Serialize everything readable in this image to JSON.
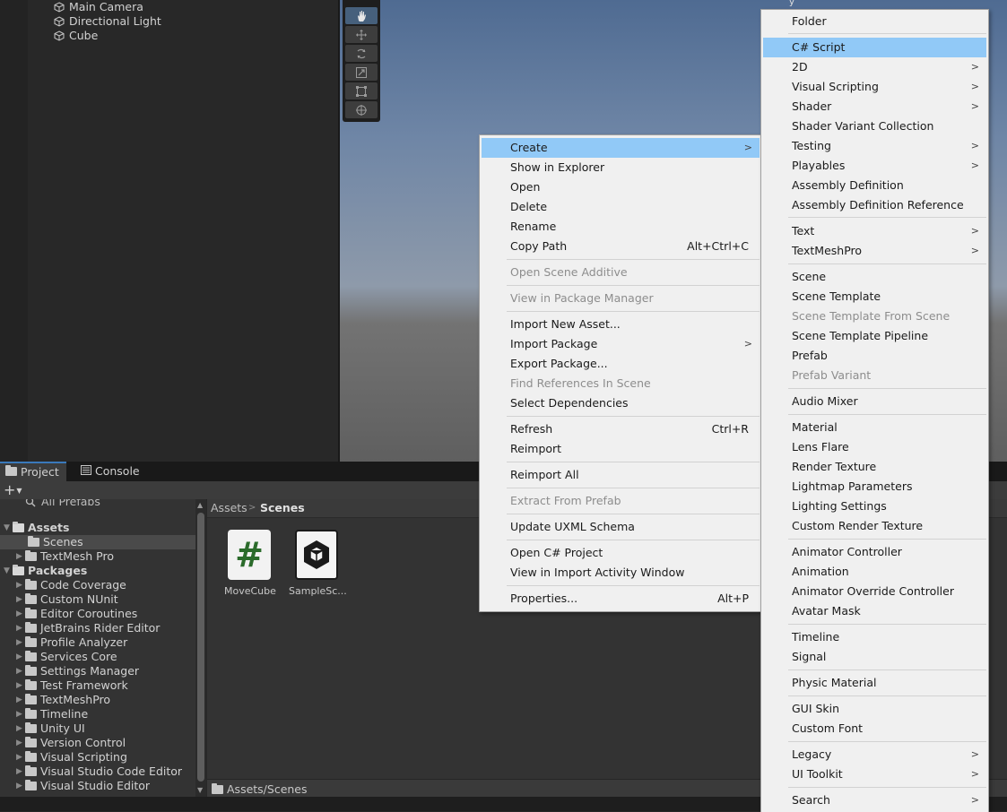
{
  "hierarchy": {
    "items": [
      "Main Camera",
      "Directional Light",
      "Cube"
    ]
  },
  "scene": {
    "axis_label": "y"
  },
  "tabs": {
    "project": "Project",
    "console": "Console"
  },
  "project": {
    "add_button": "+",
    "search_partial": "All Prefabs",
    "tree": [
      {
        "label": "Assets",
        "bold": true
      },
      {
        "label": "Scenes"
      },
      {
        "label": "TextMesh Pro"
      },
      {
        "label": "Packages",
        "bold": true
      },
      {
        "label": "Code Coverage"
      },
      {
        "label": "Custom NUnit"
      },
      {
        "label": "Editor Coroutines"
      },
      {
        "label": "JetBrains Rider Editor"
      },
      {
        "label": "Profile Analyzer"
      },
      {
        "label": "Services Core"
      },
      {
        "label": "Settings Manager"
      },
      {
        "label": "Test Framework"
      },
      {
        "label": "TextMeshPro"
      },
      {
        "label": "Timeline"
      },
      {
        "label": "Unity UI"
      },
      {
        "label": "Version Control"
      },
      {
        "label": "Visual Scripting"
      },
      {
        "label": "Visual Studio Code Editor"
      },
      {
        "label": "Visual Studio Editor"
      }
    ],
    "breadcrumb": {
      "root": "Assets",
      "separator": ">",
      "current": "Scenes"
    },
    "assets": [
      {
        "label": "MoveCube",
        "icon": "csharp-script-icon",
        "glyph": "#"
      },
      {
        "label": "SampleSc...",
        "icon": "unity-scene-icon"
      }
    ],
    "status_path": "Assets/Scenes"
  },
  "context_menu": {
    "items": [
      {
        "label": "Create",
        "submenu": true,
        "highlight": true
      },
      {
        "label": "Show in Explorer"
      },
      {
        "label": "Open"
      },
      {
        "label": "Delete"
      },
      {
        "label": "Rename"
      },
      {
        "label": "Copy Path",
        "shortcut": "Alt+Ctrl+C"
      },
      {
        "label": "Open Scene Additive",
        "disabled": true
      },
      {
        "label": "View in Package Manager",
        "disabled": true
      },
      {
        "label": "Import New Asset..."
      },
      {
        "label": "Import Package",
        "submenu": true
      },
      {
        "label": "Export Package..."
      },
      {
        "label": "Find References In Scene",
        "disabled": true
      },
      {
        "label": "Select Dependencies"
      },
      {
        "label": "Refresh",
        "shortcut": "Ctrl+R"
      },
      {
        "label": "Reimport"
      },
      {
        "label": "Reimport All"
      },
      {
        "label": "Extract From Prefab",
        "disabled": true
      },
      {
        "label": "Update UXML Schema"
      },
      {
        "label": "Open C# Project"
      },
      {
        "label": "View in Import Activity Window"
      },
      {
        "label": "Properties...",
        "shortcut": "Alt+P"
      }
    ]
  },
  "create_menu": {
    "items": [
      {
        "label": "Folder"
      },
      {
        "label": "C# Script",
        "highlight": true
      },
      {
        "label": "2D",
        "submenu": true
      },
      {
        "label": "Visual Scripting",
        "submenu": true
      },
      {
        "label": "Shader",
        "submenu": true
      },
      {
        "label": "Shader Variant Collection"
      },
      {
        "label": "Testing",
        "submenu": true
      },
      {
        "label": "Playables",
        "submenu": true
      },
      {
        "label": "Assembly Definition"
      },
      {
        "label": "Assembly Definition Reference"
      },
      {
        "label": "Text",
        "submenu": true
      },
      {
        "label": "TextMeshPro",
        "submenu": true
      },
      {
        "label": "Scene"
      },
      {
        "label": "Scene Template"
      },
      {
        "label": "Scene Template From Scene",
        "disabled": true
      },
      {
        "label": "Scene Template Pipeline"
      },
      {
        "label": "Prefab"
      },
      {
        "label": "Prefab Variant",
        "disabled": true
      },
      {
        "label": "Audio Mixer"
      },
      {
        "label": "Material"
      },
      {
        "label": "Lens Flare"
      },
      {
        "label": "Render Texture"
      },
      {
        "label": "Lightmap Parameters"
      },
      {
        "label": "Lighting Settings"
      },
      {
        "label": "Custom Render Texture"
      },
      {
        "label": "Animator Controller"
      },
      {
        "label": "Animation"
      },
      {
        "label": "Animator Override Controller"
      },
      {
        "label": "Avatar Mask"
      },
      {
        "label": "Timeline"
      },
      {
        "label": "Signal"
      },
      {
        "label": "Physic Material"
      },
      {
        "label": "GUI Skin"
      },
      {
        "label": "Custom Font"
      },
      {
        "label": "Legacy",
        "submenu": true
      },
      {
        "label": "UI Toolkit",
        "submenu": true
      },
      {
        "label": "Search",
        "submenu": true
      }
    ]
  },
  "colors": {
    "menu_highlight": "#91c9f7",
    "tab_accent": "#3a79bb",
    "script_hash": "#2b6b2b"
  }
}
